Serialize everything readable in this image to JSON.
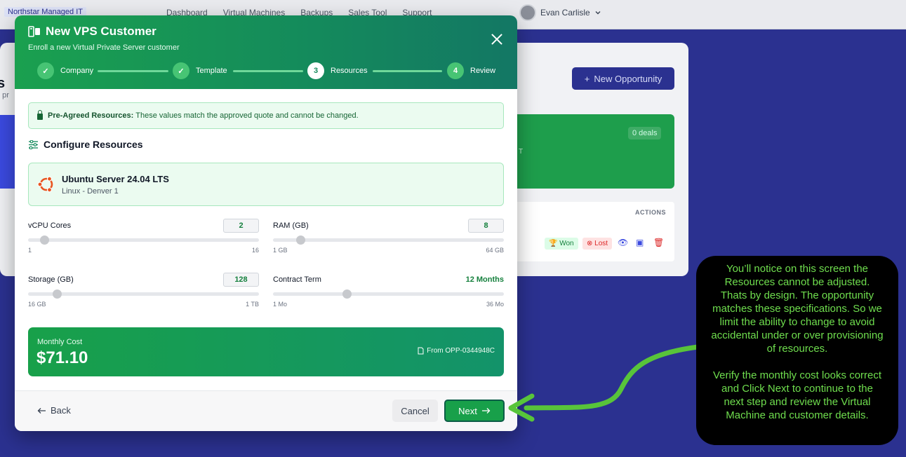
{
  "topnav": {
    "brand": "Northstar Managed IT",
    "links": [
      "Dashboard",
      "Virtual Machines",
      "Backups",
      "Sales Tool",
      "Support"
    ],
    "user_name": "Evan Carlisle"
  },
  "background": {
    "title": "s",
    "subtitle": "h pr",
    "new_opportunity": "New Opportunity",
    "deals": "0 deals",
    "stat_fragment": "T",
    "actions_header": "ACTIONS",
    "won": "Won",
    "lost": "Lost"
  },
  "modal": {
    "title": "New VPS Customer",
    "subtitle": "Enroll a new Virtual Private Server customer",
    "steps": [
      {
        "num": "1",
        "label": "Company",
        "state": "done"
      },
      {
        "num": "2",
        "label": "Template",
        "state": "done"
      },
      {
        "num": "3",
        "label": "Resources",
        "state": "active"
      },
      {
        "num": "4",
        "label": "Review",
        "state": "pending"
      }
    ],
    "notice_bold": "Pre-Agreed Resources:",
    "notice_text": "These values match the approved quote and cannot be changed.",
    "section_title": "Configure Resources",
    "template": {
      "name": "Ubuntu Server 24.04 LTS",
      "sub": "Linux - Denver 1"
    },
    "resources": {
      "vcpu": {
        "label": "vCPU Cores",
        "value": "2",
        "min": "1",
        "max": "16",
        "level": 0.07
      },
      "ram": {
        "label": "RAM (GB)",
        "value": "8",
        "min": "1 GB",
        "max": "64 GB",
        "level": 0.12
      },
      "storage": {
        "label": "Storage (GB)",
        "value": "128",
        "min": "16 GB",
        "max": "1 TB",
        "level": 0.125
      },
      "term": {
        "label": "Contract Term",
        "value": "12 Months",
        "min": "1 Mo",
        "max": "36 Mo",
        "level": 0.32
      }
    },
    "cost": {
      "label": "Monthly Cost",
      "value": "$71.10",
      "from": "From OPP-0344948C"
    },
    "footer": {
      "back": "Back",
      "cancel": "Cancel",
      "next": "Next"
    }
  },
  "callout": {
    "para1": "You’ll notice on this screen the Resources cannot be adjusted. Thats by design. The opportunity matches these specifications. So we limit the ability to change to avoid accidental under or over provisioning of resources.",
    "para2": "Verify the monthly cost looks correct and Click Next to continue to the next step and review the Virtual Machine and customer details."
  },
  "colors": {
    "accent_green": "#18a04a",
    "backdrop": "#2b3190",
    "callout_text": "#6fde4e"
  }
}
